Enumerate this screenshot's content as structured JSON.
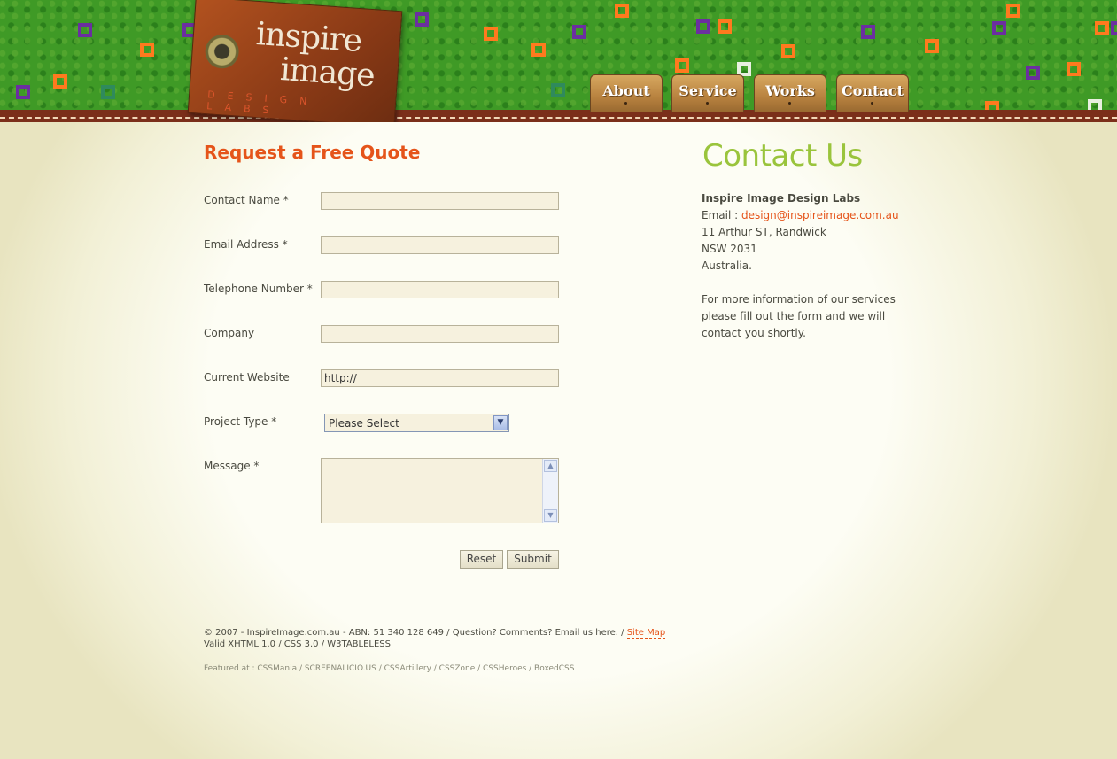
{
  "logo": {
    "line1": "inspire",
    "line2": "image",
    "sub": "DESIGN LABS"
  },
  "nav": [
    "About",
    "Service",
    "Works",
    "Contact"
  ],
  "form": {
    "title": "Request a Free Quote",
    "fields": {
      "contact_name": {
        "label": "Contact Name *",
        "value": ""
      },
      "email": {
        "label": "Email Address *",
        "value": ""
      },
      "telephone": {
        "label": "Telephone Number *",
        "value": ""
      },
      "company": {
        "label": "Company",
        "value": ""
      },
      "website": {
        "label": "Current Website",
        "value": "http://"
      },
      "project_type": {
        "label": "Project Type *",
        "selected": "Please Select"
      },
      "message": {
        "label": "Message *",
        "value": ""
      }
    },
    "reset_label": "Reset",
    "submit_label": "Submit"
  },
  "contact": {
    "title": "Contact Us",
    "company": "Inspire Image Design Labs",
    "email_label": "Email : ",
    "email": "design@inspireimage.com.au",
    "address1": "11 Arthur ST, Randwick",
    "address2": "NSW 2031",
    "country": "Australia.",
    "blurb1": "For more information of our services",
    "blurb2": "please fill out the form and we will",
    "blurb3": "contact you shortly."
  },
  "footer": {
    "line1": "© 2007 - InspireImage.com.au - ABN: 51 340 128 649 / Question? Comments? Email us here. / ",
    "sitemap": "Site Map",
    "line2": "Valid XHTML 1.0 / CSS 3.0 / W3TABLELESS",
    "featured": "Featured at : CSSMania / SCREENALICIO.US / CSSArtillery / CSSZone / CSSHeroes / BoxedCSS"
  },
  "colors": {
    "accent": "#e5541a",
    "green_title": "#9ac43c",
    "header_green": "#3f9a26"
  }
}
